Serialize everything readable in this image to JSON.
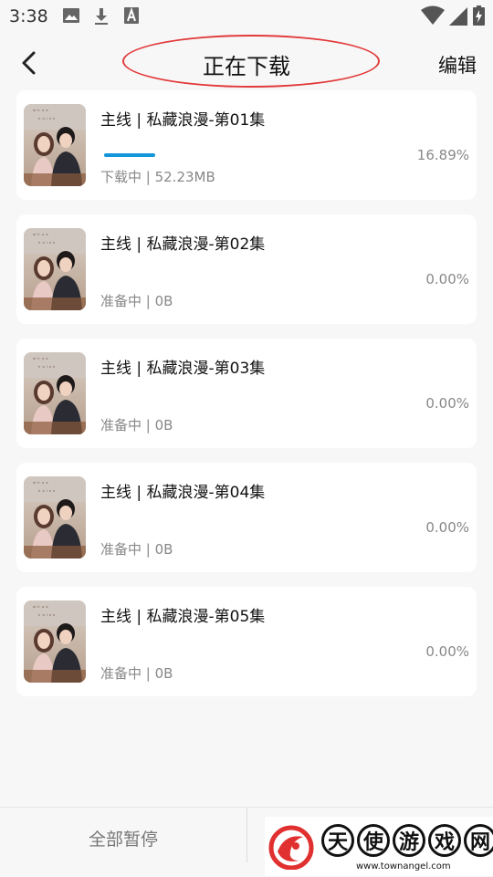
{
  "status_bar": {
    "time": "3:38",
    "icons": [
      "image-icon",
      "download-icon",
      "a-box-icon",
      "wifi-icon",
      "signal-icon",
      "battery-icon"
    ]
  },
  "header": {
    "back_icon": "chevron-left-icon",
    "title": "正在下载",
    "edit_label": "编辑",
    "highlight_color": "#e23a3a"
  },
  "downloads": [
    {
      "title": "主线 | 私藏浪漫-第01集",
      "status": "下载中 | 52.23MB",
      "percent": "16.89%",
      "progress": 0.1689
    },
    {
      "title": "主线 | 私藏浪漫-第02集",
      "status": "准备中 | 0B",
      "percent": "0.00%",
      "progress": 0
    },
    {
      "title": "主线 | 私藏浪漫-第03集",
      "status": "准备中 | 0B",
      "percent": "0.00%",
      "progress": 0
    },
    {
      "title": "主线 | 私藏浪漫-第04集",
      "status": "准备中 | 0B",
      "percent": "0.00%",
      "progress": 0
    },
    {
      "title": "主线 | 私藏浪漫-第05集",
      "status": "准备中 | 0B",
      "percent": "0.00%",
      "progress": 0
    }
  ],
  "bottom": {
    "pause_all_label": "全部暂停"
  },
  "watermark": {
    "chars": [
      "天",
      "使",
      "游",
      "戏",
      "网"
    ],
    "url": "www.townangel.com"
  },
  "colors": {
    "progress": "#1296db",
    "background": "#f7f7f7"
  }
}
